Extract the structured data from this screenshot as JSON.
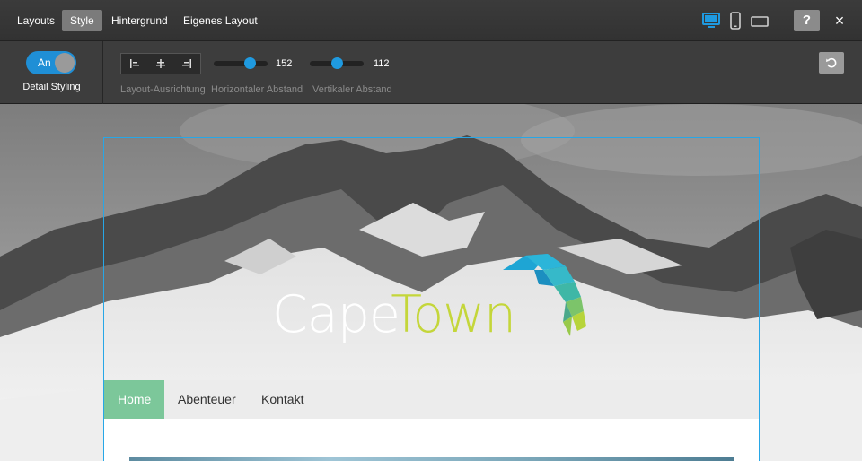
{
  "topbar": {
    "tabs": [
      {
        "label": "Layouts",
        "active": false
      },
      {
        "label": "Style",
        "active": true
      },
      {
        "label": "Hintergrund",
        "active": false
      },
      {
        "label": "Eigenes Layout",
        "active": false
      }
    ],
    "devices": [
      "desktop-icon",
      "mobile-icon",
      "tablet-landscape-icon"
    ],
    "active_device": "desktop",
    "help_label": "?",
    "close_label": "×",
    "accent_color": "#1f9ae0"
  },
  "toolbar": {
    "toggle": {
      "label": "An",
      "on": true
    },
    "detail_styling_label": "Detail Styling",
    "alignment_caption": "Layout-Ausrichtung",
    "alignment_options": [
      "align-left-icon",
      "align-center-icon",
      "align-right-icon"
    ],
    "horizontal": {
      "caption": "Horizontaler Abstand",
      "value": "152",
      "level": 0.72
    },
    "vertical": {
      "caption": "Vertikaler Abstand",
      "value": "112",
      "level": 0.52
    },
    "reset_icon": "reset-icon"
  },
  "preview": {
    "logo": {
      "part1": "Cape",
      "part2": "Town"
    },
    "nav": [
      "Home",
      "Abenteuer",
      "Kontakt"
    ],
    "active_nav": "Home",
    "colors": {
      "selection": "#27a7e7",
      "logo_accent": "#c4d63a",
      "nav_active": "#7cc79a"
    }
  }
}
